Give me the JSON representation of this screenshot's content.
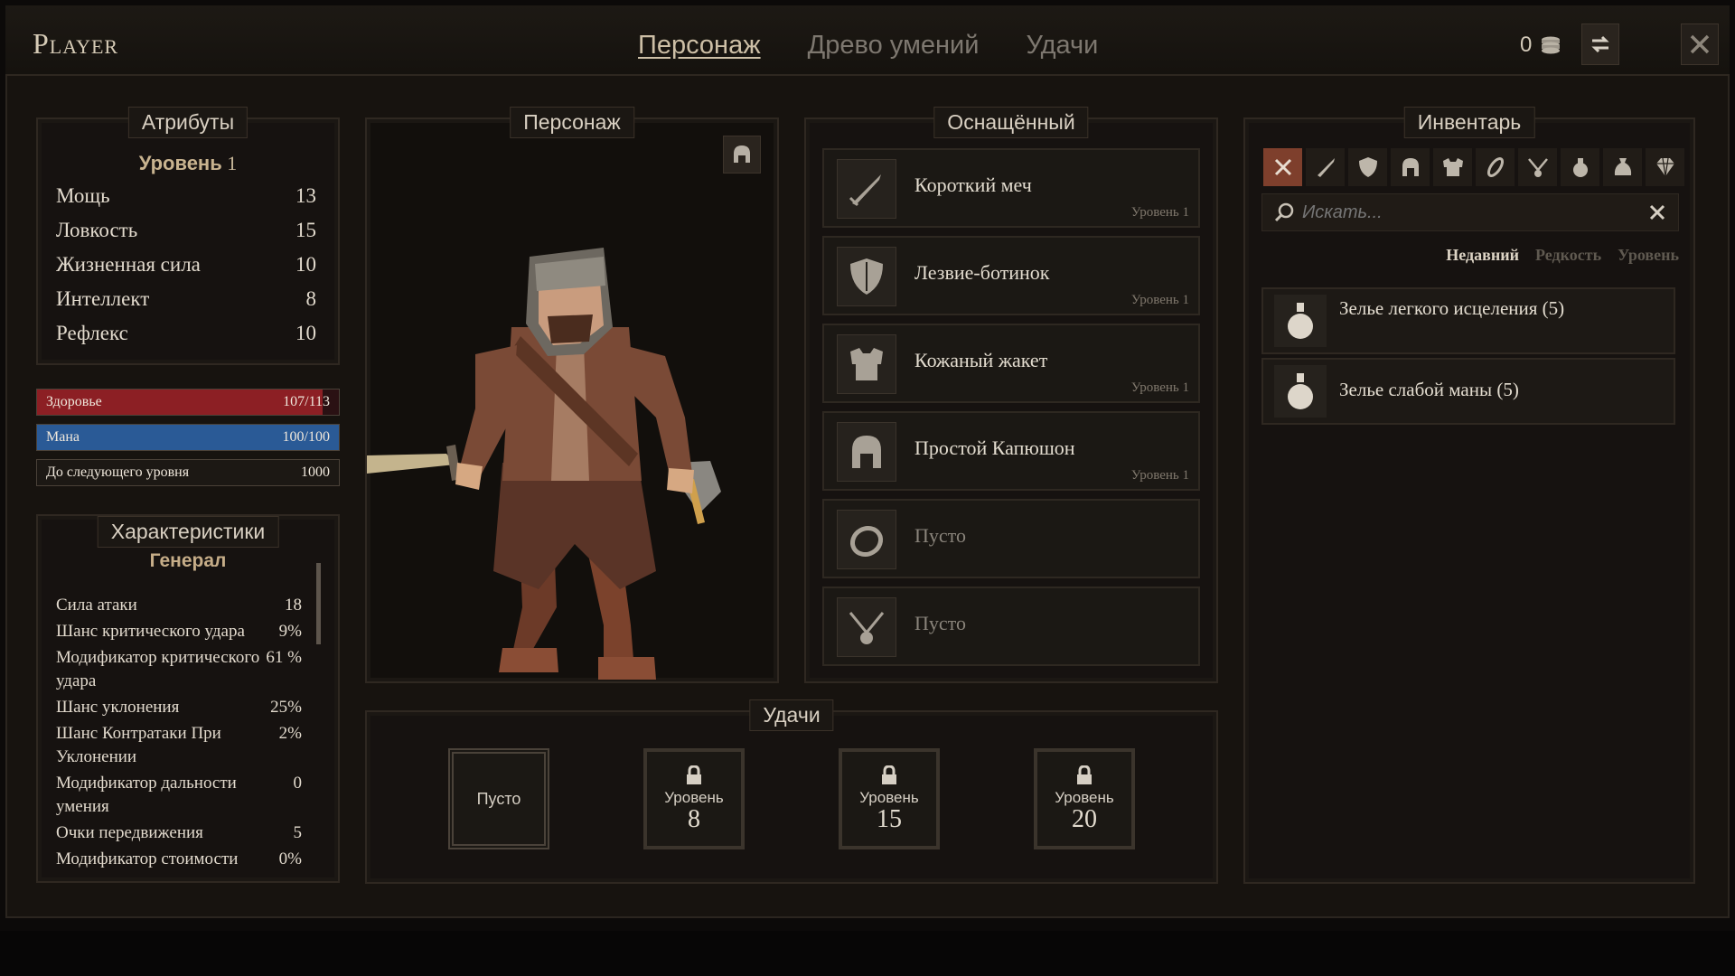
{
  "header": {
    "title": "Player",
    "tabs": [
      {
        "label": "Персонаж",
        "active": true
      },
      {
        "label": "Древо умений",
        "active": false
      },
      {
        "label": "Удачи",
        "active": false
      }
    ],
    "gold": "0"
  },
  "attributes": {
    "title": "Атрибуты",
    "level_label": "Уровень",
    "level_value": "1",
    "items": [
      {
        "name": "Мощь",
        "value": "13"
      },
      {
        "name": "Ловкость",
        "value": "15"
      },
      {
        "name": "Жизненная сила",
        "value": "10"
      },
      {
        "name": "Интеллект",
        "value": "8"
      },
      {
        "name": "Рефлекс",
        "value": "10"
      }
    ]
  },
  "bars": {
    "health": {
      "label": "Здоровье",
      "value": "107/113",
      "fraction": 0.947,
      "color": "#8c1f24"
    },
    "mana": {
      "label": "Мана",
      "value": "100/100",
      "fraction": 1.0,
      "color": "#2a5a96"
    },
    "next_level": {
      "label": "До следующего уровня",
      "value": "1000"
    }
  },
  "characteristics": {
    "title": "Характеристики",
    "group": "Генерал",
    "items": [
      {
        "name": "Сила атаки",
        "value": "18"
      },
      {
        "name": "Шанс критического удара",
        "value": "9%"
      },
      {
        "name": "Модификатор критического удара",
        "value": "61 %"
      },
      {
        "name": "Шанс уклонения",
        "value": "25%"
      },
      {
        "name": "Шанс Контратаки При Уклонении",
        "value": "2%"
      },
      {
        "name": "Модификатор дальности умения",
        "value": "0"
      },
      {
        "name": "Очки передвижения",
        "value": "5"
      },
      {
        "name": "Модификатор стоимости",
        "value": "0%"
      }
    ]
  },
  "character": {
    "title": "Персонаж",
    "helm_toggle_icon": "helmet-icon"
  },
  "equipped": {
    "title": "Оснащённый",
    "slots": [
      {
        "name": "Короткий меч",
        "level": "Уровень 1",
        "icon": "sword-icon"
      },
      {
        "name": "Лезвие-ботинок",
        "level": "Уровень 1",
        "icon": "shield-icon"
      },
      {
        "name": "Кожаный жакет",
        "level": "Уровень 1",
        "icon": "armor-icon"
      },
      {
        "name": "Простой Капюшон",
        "level": "Уровень 1",
        "icon": "helmet-icon"
      },
      {
        "name": "Пусто",
        "level": "",
        "icon": "ring-icon"
      },
      {
        "name": "Пусто",
        "level": "",
        "icon": "amulet-icon"
      }
    ]
  },
  "inventory": {
    "title": "Инвентарь",
    "filters": [
      "close-icon",
      "sword-icon",
      "shield-icon",
      "helmet-icon",
      "armor-icon",
      "boots-icon",
      "amulet-icon",
      "potion-icon",
      "bag-icon",
      "gem-icon"
    ],
    "search_placeholder": "Искать...",
    "sort": [
      {
        "label": "Недавний",
        "active": true
      },
      {
        "label": "Редкость",
        "active": false
      },
      {
        "label": "Уровень",
        "active": false
      }
    ],
    "items": [
      {
        "name": "Зелье легкого исцеления (5)",
        "icon": "potion-icon"
      },
      {
        "name": "Зелье слабой маны  (5)",
        "icon": "potion-icon"
      }
    ]
  },
  "feats": {
    "title": "Удачи",
    "slots": [
      {
        "state": "open",
        "text": "Пусто"
      },
      {
        "state": "locked",
        "label": "Уровень",
        "level": "8"
      },
      {
        "state": "locked",
        "label": "Уровень",
        "level": "15"
      },
      {
        "state": "locked",
        "label": "Уровень",
        "level": "20"
      }
    ]
  },
  "colors": {
    "accent": "#7e3f2c",
    "panel": "#161210",
    "text": "#e2dacd"
  }
}
